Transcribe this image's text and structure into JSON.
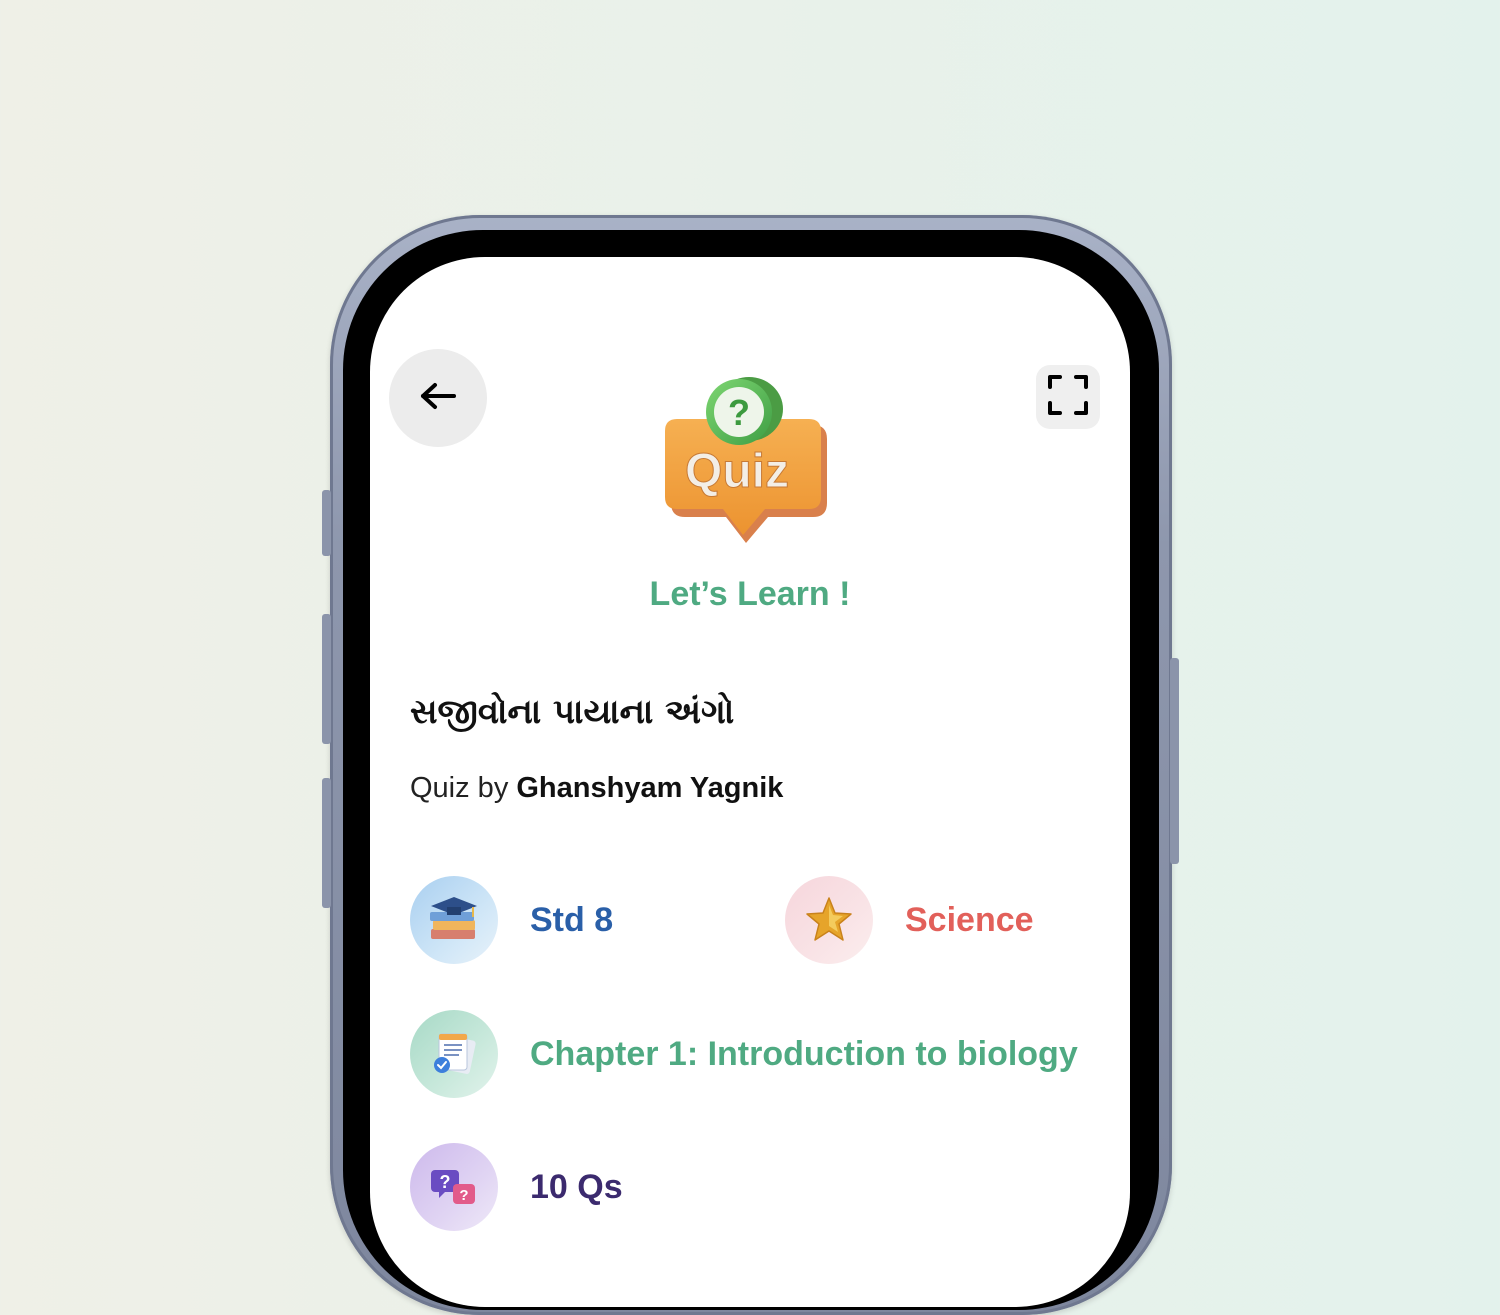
{
  "header": {
    "back_icon": "arrow-left-icon",
    "expand_icon": "fullscreen-icon",
    "logo_text": "Quiz",
    "tagline": "Let’s Learn !"
  },
  "quiz": {
    "title": "સજીવોના પાયાના અંગો",
    "byline_prefix": "Quiz by ",
    "author": "Ghanshyam Yagnik"
  },
  "details": {
    "standard": {
      "label": "Std 8",
      "icon": "graduation-books-icon",
      "color": "#2a5fa8"
    },
    "subject": {
      "label": "Science",
      "icon": "gold-star-icon",
      "color": "#e2605a"
    },
    "chapter": {
      "label": "Chapter 1: Introduction to biology",
      "icon": "document-check-icon",
      "color": "#4faa82"
    },
    "questions": {
      "label": "10 Qs",
      "icon": "question-cards-icon",
      "color": "#3b2a6e"
    }
  },
  "colors": {
    "accent_green": "#4faa82",
    "quiz_orange": "#f0a040",
    "quiz_question_green": "#4caf50"
  }
}
